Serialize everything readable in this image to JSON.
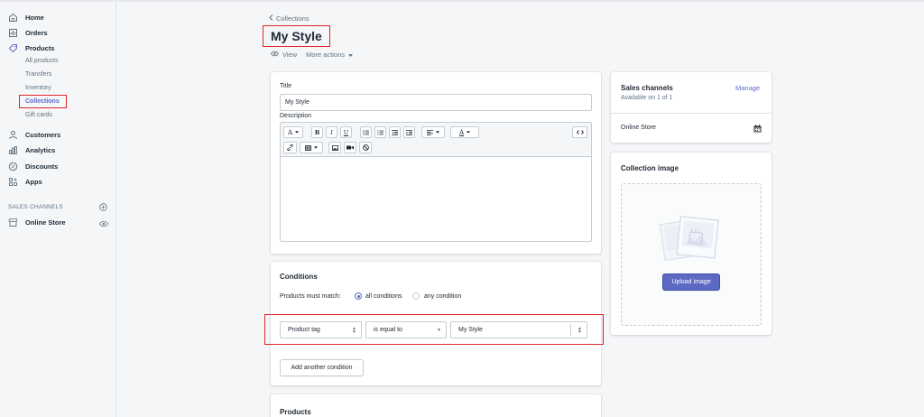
{
  "sidebar": {
    "nav": [
      {
        "label": "Home",
        "icon": "home-icon"
      },
      {
        "label": "Orders",
        "icon": "orders-icon"
      },
      {
        "label": "Products",
        "icon": "products-tag-icon"
      }
    ],
    "products_sub": [
      "All products",
      "Transfers",
      "Inventory",
      "Collections",
      "Gift cards"
    ],
    "nav2": [
      {
        "label": "Customers",
        "icon": "customers-icon"
      },
      {
        "label": "Analytics",
        "icon": "analytics-icon"
      },
      {
        "label": "Discounts",
        "icon": "discounts-icon"
      },
      {
        "label": "Apps",
        "icon": "apps-icon"
      }
    ],
    "sales_channels_heading": "SALES CHANNELS",
    "online_store": "Online Store"
  },
  "header": {
    "breadcrumb": "Collections",
    "title": "My Style",
    "view": "View",
    "more_actions": "More actions"
  },
  "main": {
    "title_label": "Title",
    "title_value": "My Style",
    "description_label": "Description"
  },
  "conditions": {
    "title": "Conditions",
    "match_label": "Products must match:",
    "all_conditions": "all conditions",
    "any_condition": "any condition",
    "field": "Product tag",
    "operator": "is equal to",
    "value": "My Style",
    "add_button": "Add another condition"
  },
  "products": {
    "title": "Products"
  },
  "sales_channels": {
    "title": "Sales channels",
    "manage": "Manage",
    "available": "Available on 1 of 1",
    "channel": "Online Store"
  },
  "collection_image": {
    "title": "Collection image",
    "upload": "Upload image"
  },
  "colors": {
    "accent": "#5c6ac4",
    "highlight": "#e0262b"
  }
}
